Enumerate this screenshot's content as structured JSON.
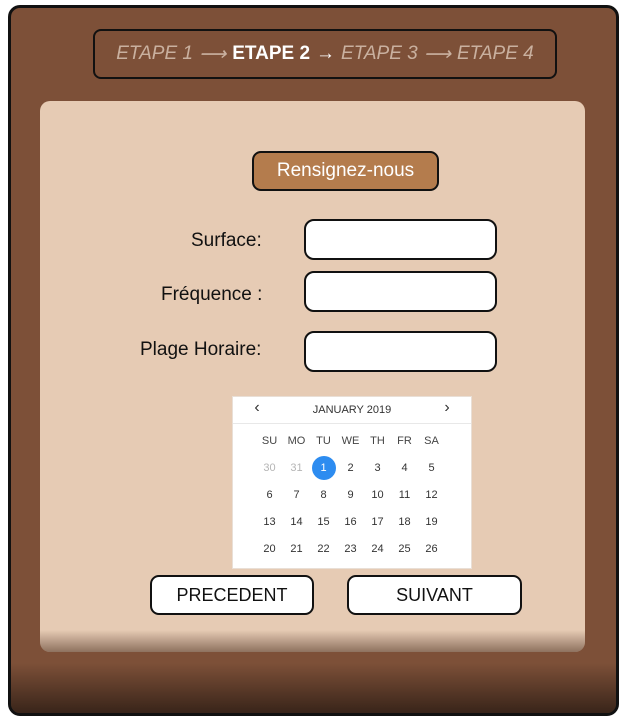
{
  "steps": {
    "items": [
      {
        "label": "ETAPE 1",
        "active": false
      },
      {
        "label": "ETAPE 2",
        "active": true
      },
      {
        "label": "ETAPE 3",
        "active": false
      },
      {
        "label": "ETAPE 4",
        "active": false
      }
    ],
    "arrow": "⟶",
    "active_arrow": "→"
  },
  "form": {
    "header_label": "Rensignez-nous",
    "fields": [
      {
        "label": "Surface:",
        "value": ""
      },
      {
        "label": "Fréquence :",
        "value": ""
      },
      {
        "label": "Plage Horaire:",
        "value": ""
      }
    ]
  },
  "calendar": {
    "month_label": "JANUARY 2019",
    "prev_icon": "‹",
    "next_icon": "›",
    "weekdays": [
      "SU",
      "MO",
      "TU",
      "WE",
      "TH",
      "FR",
      "SA"
    ],
    "weeks": [
      [
        "30",
        "31",
        "1",
        "2",
        "3",
        "4",
        "5"
      ],
      [
        "6",
        "7",
        "8",
        "9",
        "10",
        "11",
        "12"
      ],
      [
        "13",
        "14",
        "15",
        "16",
        "17",
        "18",
        "19"
      ],
      [
        "20",
        "21",
        "22",
        "23",
        "24",
        "25",
        "26"
      ]
    ],
    "selected_day": "1",
    "outside_days": [
      "30",
      "31"
    ]
  },
  "nav": {
    "prev_label": "PRECEDENT",
    "next_label": "SUIVANT"
  },
  "colors": {
    "frame_bg": "#7d5038",
    "panel_bg": "#e6cbb4",
    "header_button_bg": "#b47c4d",
    "selected_day_bg": "#2d8cf0"
  }
}
